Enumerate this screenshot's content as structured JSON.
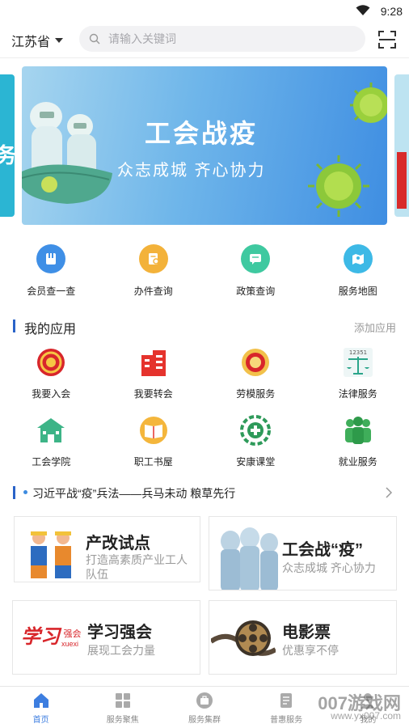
{
  "status_bar": {
    "time": "9:28"
  },
  "header": {
    "province": "江苏省",
    "search_placeholder": "请输入关键词"
  },
  "banner": {
    "title": "工会战疫",
    "subtitle": "众志成城  齐心协力",
    "left_peek_text": "务"
  },
  "quick_links": [
    {
      "label": "会员查一查",
      "icon": "member-card-icon",
      "color": "#3f8fe6"
    },
    {
      "label": "办件查询",
      "icon": "document-search-icon",
      "color": "#f3b23a"
    },
    {
      "label": "政策查询",
      "icon": "chat-icon",
      "color": "#3fc9a0"
    },
    {
      "label": "服务地图",
      "icon": "map-icon",
      "color": "#3db9e6"
    }
  ],
  "my_apps": {
    "title": "我的应用",
    "add_label": "添加应用",
    "items": [
      {
        "label": "我要入会",
        "icon": "union-emblem-icon"
      },
      {
        "label": "我要转会",
        "icon": "building-icon"
      },
      {
        "label": "劳模服务",
        "icon": "medal-icon"
      },
      {
        "label": "法律服务",
        "icon": "scales-icon",
        "badge_text": "12351"
      },
      {
        "label": "工会学院",
        "icon": "school-icon"
      },
      {
        "label": "职工书屋",
        "icon": "book-icon"
      },
      {
        "label": "安康课堂",
        "icon": "safety-cross-icon"
      },
      {
        "label": "就业服务",
        "icon": "people-icon"
      }
    ]
  },
  "news": {
    "text": "习近平战“疫”兵法——兵马未动 粮草先行"
  },
  "cards": [
    {
      "title": "产改试点",
      "subtitle": "打造高素质产业工人队伍"
    },
    {
      "title": "工会战“疫”",
      "subtitle": "众志成城  齐心协力"
    },
    {
      "title": "学习强会",
      "subtitle": "展现工会力量",
      "logo_text": "学习",
      "logo_tail": "强会",
      "logo_sub": "xuexi"
    },
    {
      "title": "电影票",
      "subtitle": "优惠享不停"
    }
  ],
  "tabs": [
    {
      "label": "首页",
      "icon": "home-icon",
      "active": true
    },
    {
      "label": "服务聚焦",
      "icon": "grid-icon",
      "active": false
    },
    {
      "label": "服务集群",
      "icon": "briefcase-icon",
      "active": false
    },
    {
      "label": "普惠服务",
      "icon": "document-icon",
      "active": false
    },
    {
      "label": "我的",
      "icon": "user-icon",
      "active": false
    }
  ],
  "watermark": {
    "brand": "007游戏网",
    "url": "www.yx007.com"
  },
  "colors": {
    "accent": "#2a63c8",
    "tab_active": "#3d7ee0"
  }
}
